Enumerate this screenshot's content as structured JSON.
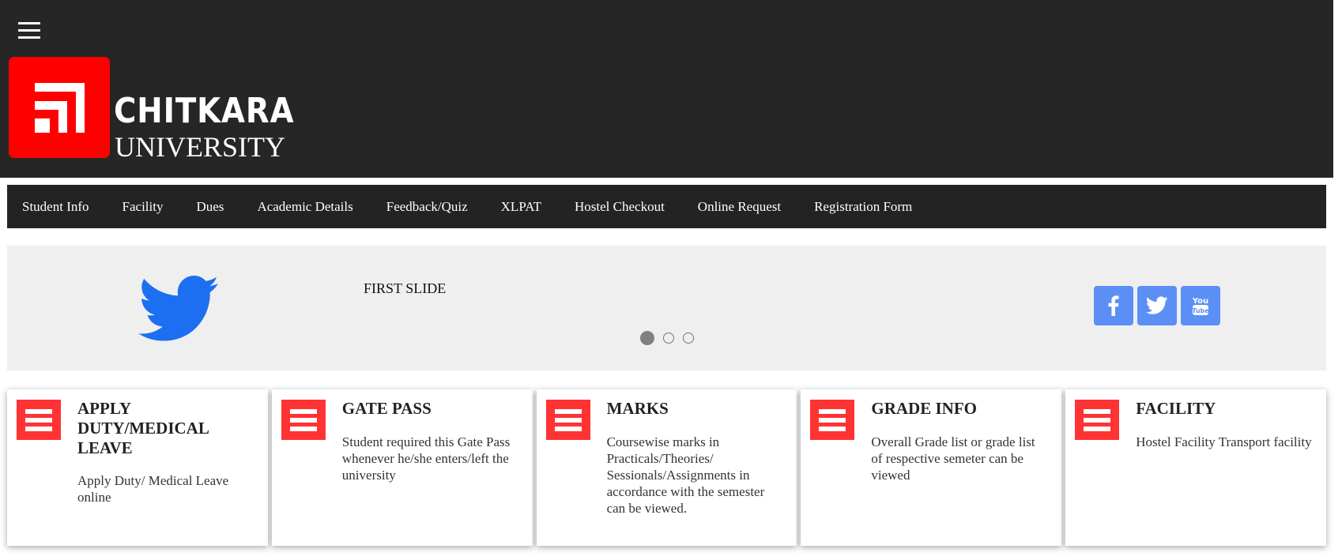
{
  "header": {
    "menu_icon": "hamburger-menu-icon",
    "logo_icon": "chitkara-logo-icon",
    "logo_line1": "CHITKARA",
    "logo_line2": "UNIVERSITY",
    "background": "#262626",
    "logo_color": "#ff0000"
  },
  "nav": {
    "items": [
      {
        "label": "Student Info"
      },
      {
        "label": "Facility"
      },
      {
        "label": "Dues"
      },
      {
        "label": "Academic Details"
      },
      {
        "label": "Feedback/Quiz"
      },
      {
        "label": "XLPAT"
      },
      {
        "label": "Hostel Checkout"
      },
      {
        "label": "Online Request"
      },
      {
        "label": "Registration Form"
      }
    ]
  },
  "carousel": {
    "slide_text": "FIRST SLIDE",
    "slide_icon": "twitter-bird-icon",
    "dots": [
      {
        "active": true
      },
      {
        "active": false
      },
      {
        "active": false
      }
    ],
    "social": [
      {
        "icon": "facebook-icon"
      },
      {
        "icon": "twitter-icon"
      },
      {
        "icon": "youtube-icon"
      }
    ],
    "social_color": "#5b8ff5"
  },
  "cards": [
    {
      "title": "APPLY DUTY/MEDICAL LEAVE",
      "description": "Apply Duty/ Medical Leave online",
      "icon": "menu-list-icon"
    },
    {
      "title": "GATE PASS",
      "description": "Student required this Gate Pass whenever he/she enters/left the university",
      "icon": "menu-list-icon"
    },
    {
      "title": "MARKS",
      "description": "Coursewise marks in Practicals/Theories/ Sessionals/Assignments in accordance with the semester can be viewed.",
      "icon": "menu-list-icon"
    },
    {
      "title": "GRADE INFO",
      "description": "Overall Grade list or grade list of respective semeter can be viewed",
      "icon": "menu-list-icon"
    },
    {
      "title": "FACILITY",
      "description": "Hostel Facility Transport facility",
      "icon": "menu-list-icon"
    }
  ],
  "card_icon_color": "#ff3333"
}
